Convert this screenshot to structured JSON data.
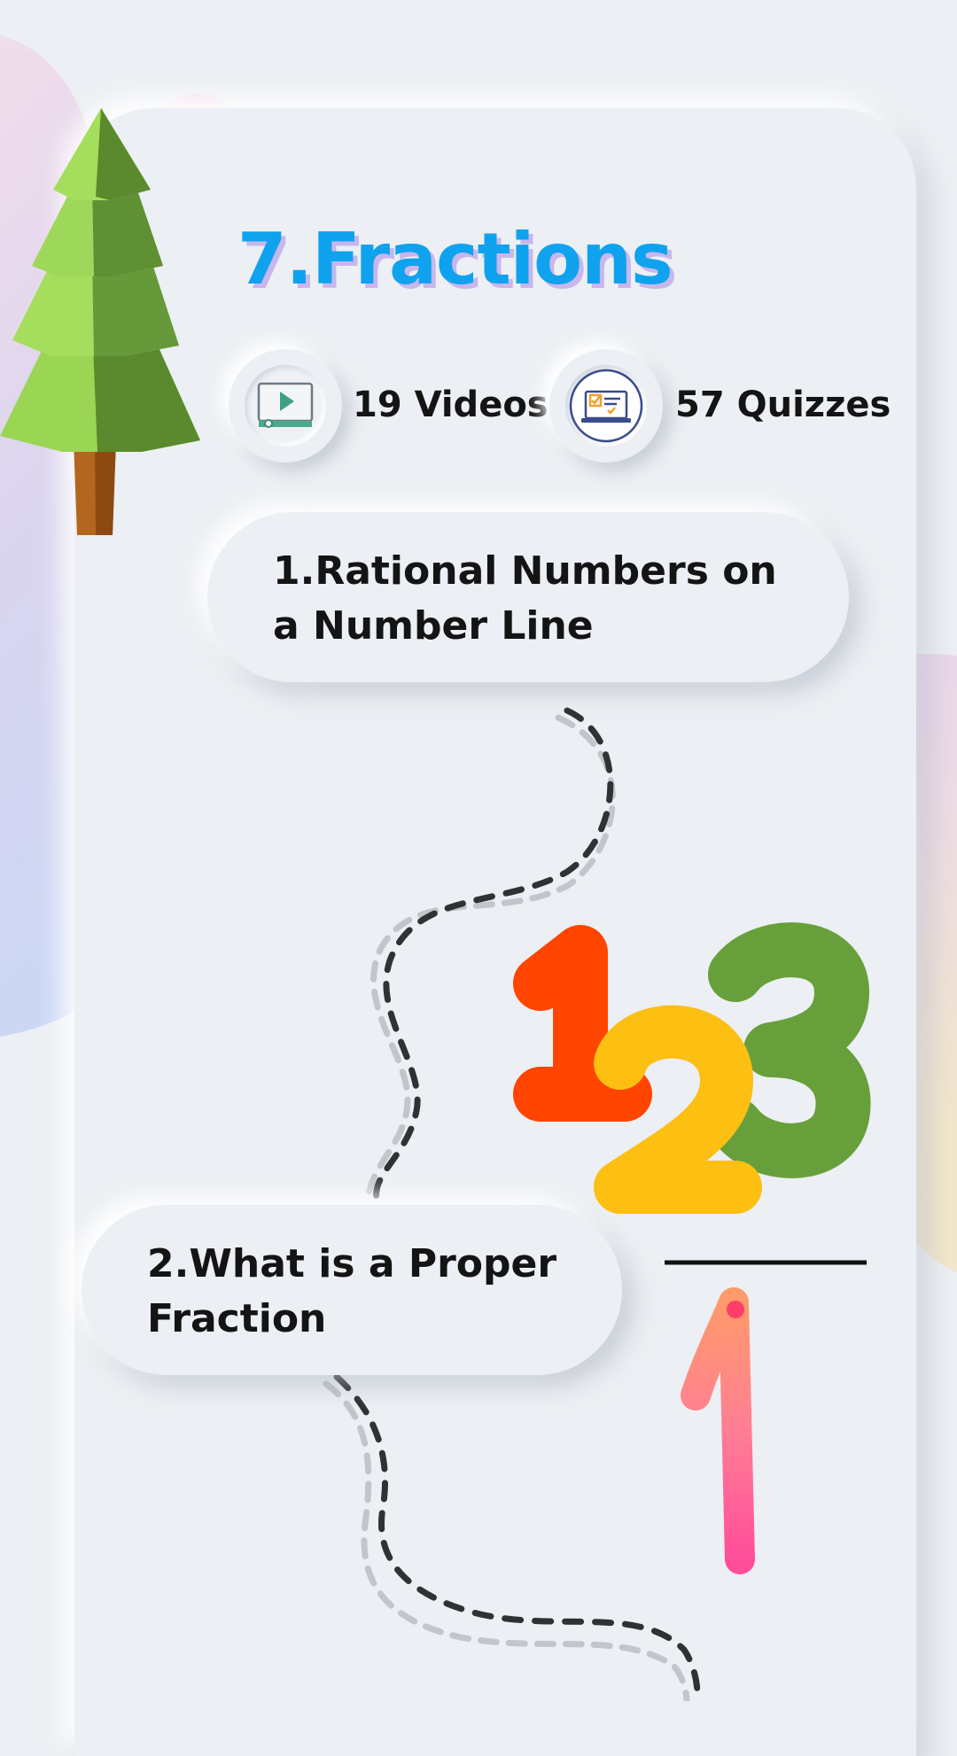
{
  "screen": {
    "title": "7.Fractions",
    "stats": [
      {
        "icon": "video-player-icon",
        "label": "19 Videos"
      },
      {
        "icon": "laptop-quiz-icon",
        "label": "57 Quizzes"
      }
    ],
    "lessons": [
      {
        "label": "1.Rational Numbers on a Number Line"
      },
      {
        "label": "2.What is a Proper Fraction"
      }
    ]
  },
  "colors": {
    "title": "#0fa2ee",
    "title_shadow": "#c8b6ec",
    "background": "#eceff3",
    "digit_1": "#ff4500",
    "digit_2": "#fcbf12",
    "digit_3": "#67a03a",
    "denominator": "#ff5f8f"
  }
}
